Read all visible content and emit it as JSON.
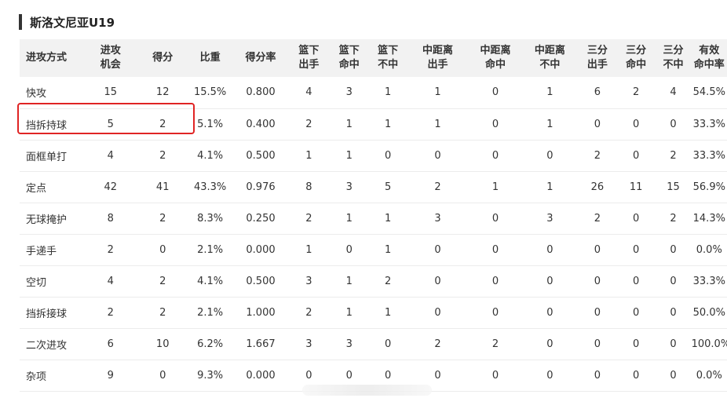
{
  "section": {
    "title": "斯洛文尼亚U19"
  },
  "table": {
    "headers": [
      "进攻方式",
      "进攻\n机会",
      "得分",
      "比重",
      "得分率",
      "篮下\n出手",
      "篮下\n命中",
      "篮下\n不中",
      "中距离\n出手",
      "中距离\n命中",
      "中距离\n不中",
      "三分\n出手",
      "三分\n命中",
      "三分\n不中",
      "有效\n命中率"
    ],
    "rows": [
      [
        "快攻",
        "15",
        "12",
        "15.5%",
        "0.800",
        "4",
        "3",
        "1",
        "1",
        "0",
        "1",
        "6",
        "2",
        "4",
        "54.5%"
      ],
      [
        "挡拆持球",
        "5",
        "2",
        "5.1%",
        "0.400",
        "2",
        "1",
        "1",
        "1",
        "0",
        "1",
        "0",
        "0",
        "0",
        "33.3%"
      ],
      [
        "面框单打",
        "4",
        "2",
        "4.1%",
        "0.500",
        "1",
        "1",
        "0",
        "0",
        "0",
        "0",
        "2",
        "0",
        "2",
        "33.3%"
      ],
      [
        "定点",
        "42",
        "41",
        "43.3%",
        "0.976",
        "8",
        "3",
        "5",
        "2",
        "1",
        "1",
        "26",
        "11",
        "15",
        "56.9%"
      ],
      [
        "无球掩护",
        "8",
        "2",
        "8.3%",
        "0.250",
        "2",
        "1",
        "1",
        "3",
        "0",
        "3",
        "2",
        "0",
        "2",
        "14.3%"
      ],
      [
        "手递手",
        "2",
        "0",
        "2.1%",
        "0.000",
        "1",
        "0",
        "1",
        "0",
        "0",
        "0",
        "0",
        "0",
        "0",
        "0.0%"
      ],
      [
        "空切",
        "4",
        "2",
        "4.1%",
        "0.500",
        "3",
        "1",
        "2",
        "0",
        "0",
        "0",
        "0",
        "0",
        "0",
        "33.3%"
      ],
      [
        "挡拆接球",
        "2",
        "2",
        "2.1%",
        "1.000",
        "2",
        "1",
        "1",
        "0",
        "0",
        "0",
        "0",
        "0",
        "0",
        "50.0%"
      ],
      [
        "二次进攻",
        "6",
        "10",
        "6.2%",
        "1.667",
        "3",
        "3",
        "0",
        "2",
        "2",
        "0",
        "0",
        "0",
        "0",
        "100.0%"
      ],
      [
        "杂项",
        "9",
        "0",
        "9.3%",
        "0.000",
        "0",
        "0",
        "0",
        "0",
        "0",
        "0",
        "0",
        "0",
        "0",
        "0.0%"
      ]
    ]
  },
  "colors": {
    "link": "#2f6cb4",
    "highlight": "#e02424",
    "header_bg": "#f2f2f2"
  }
}
